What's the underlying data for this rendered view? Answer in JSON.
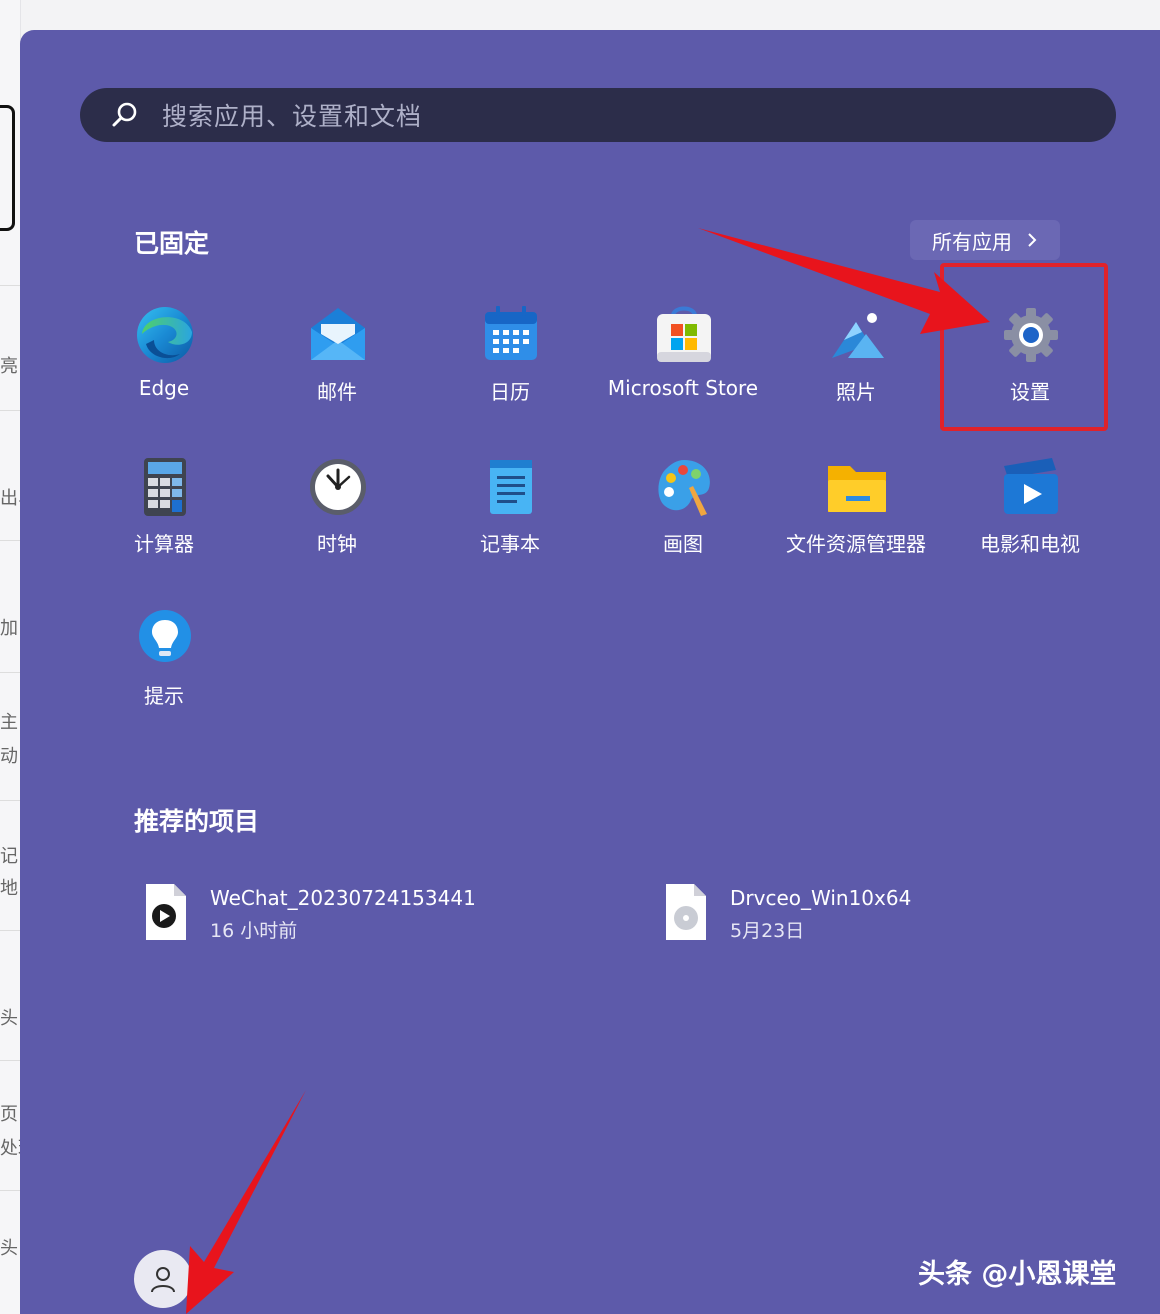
{
  "search": {
    "placeholder": "搜索应用、设置和文档"
  },
  "pinned": {
    "title": "已固定",
    "all_apps_label": "所有应用",
    "apps": [
      {
        "label": "Edge",
        "icon": "edge-icon"
      },
      {
        "label": "邮件",
        "icon": "mail-icon"
      },
      {
        "label": "日历",
        "icon": "calendar-icon"
      },
      {
        "label": "Microsoft Store",
        "icon": "store-icon"
      },
      {
        "label": "照片",
        "icon": "photos-icon"
      },
      {
        "label": "设置",
        "icon": "gear-icon"
      },
      {
        "label": "计算器",
        "icon": "calculator-icon"
      },
      {
        "label": "时钟",
        "icon": "clock-icon"
      },
      {
        "label": "记事本",
        "icon": "notepad-icon"
      },
      {
        "label": "画图",
        "icon": "paint-icon"
      },
      {
        "label": "文件资源管理器",
        "icon": "folder-icon"
      },
      {
        "label": "电影和电视",
        "icon": "movies-icon"
      },
      {
        "label": "提示",
        "icon": "tips-icon"
      }
    ]
  },
  "recommended": {
    "title": "推荐的项目",
    "items": [
      {
        "name": "WeChat_20230724153441",
        "time": "16 小时前",
        "icon": "video-file-icon"
      },
      {
        "name": "Drvceo_Win10x64",
        "time": "5月23日",
        "icon": "disc-image-file-icon"
      }
    ]
  },
  "background_fragments": [
    "亮",
    "出、",
    "加",
    "主",
    "动",
    "记",
    "地",
    "头",
    "页",
    "处理",
    "头"
  ],
  "watermark": "头条 @小恩课堂",
  "colors": {
    "menu_bg": "#5d5aaa",
    "search_bg": "#2c2d4a",
    "highlight": "#e0222a",
    "arrow": "#e8141c"
  }
}
